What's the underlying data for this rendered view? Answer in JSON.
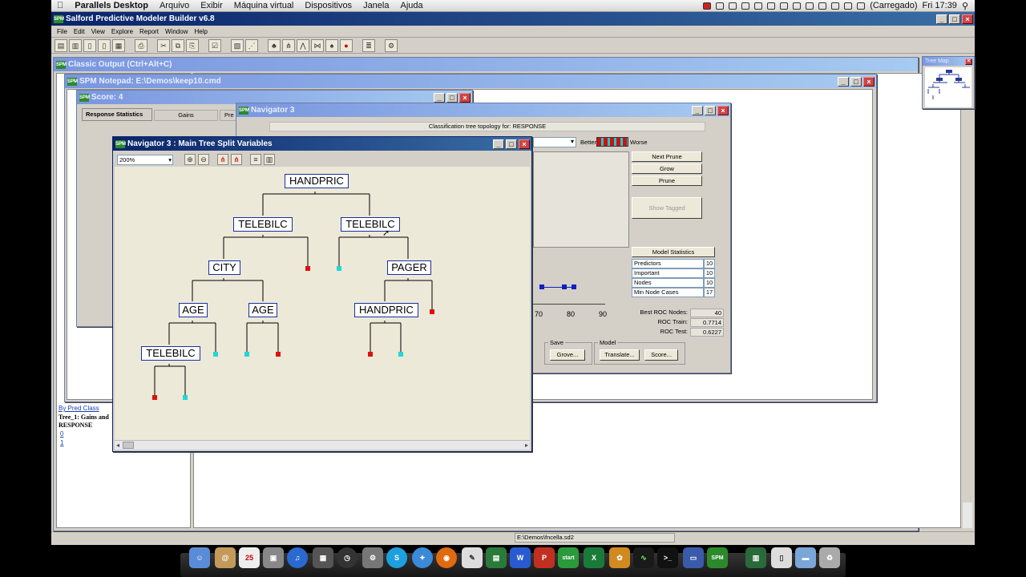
{
  "mac_menu": {
    "app": "Parallels Desktop",
    "items": [
      "Arquivo",
      "Exibir",
      "Máquina virtual",
      "Dispositivos",
      "Janela",
      "Ajuda"
    ],
    "battery": "(Carregado)",
    "clock": "Fri 17:39"
  },
  "app": {
    "title": "Salford Predictive Modeler Builder v6.8",
    "menu": [
      "File",
      "Edit",
      "View",
      "Explore",
      "Report",
      "Window",
      "Help"
    ]
  },
  "classic_output": {
    "title": "Classic Output (Ctrl+Alt+C)",
    "bottom_link": "By Pred Class",
    "bottom_line1": "Tree_1: Gains and",
    "bottom_line2": "RESPONSE",
    "bottom_v0": "0",
    "bottom_v1": "1"
  },
  "notepad": {
    "title": "SPM Notepad: E:\\Demos\\keep10.cmd"
  },
  "score": {
    "title": "Score: 4",
    "tabs": [
      "Response Statistics",
      "Gains",
      "Pre"
    ]
  },
  "navigator3": {
    "title": "Navigator 3",
    "topology_label": "Classification tree topology for: RESPONSE",
    "better": "Better",
    "worse": "Worse",
    "buttons": {
      "next_prune": "Next Prune",
      "grow": "Grow",
      "prune": "Prune",
      "show_tagged": "Show Tagged"
    },
    "model_statistics": {
      "header": "Model Statistics",
      "rows": [
        {
          "label": "Predictors",
          "value": "10"
        },
        {
          "label": "Important",
          "value": "10"
        },
        {
          "label": "Nodes",
          "value": "10"
        },
        {
          "label": "Min Node Cases",
          "value": "17"
        }
      ]
    },
    "roc": [
      {
        "label": "Best ROC Nodes:",
        "value": "40"
      },
      {
        "label": "ROC Train:",
        "value": "0.7714"
      },
      {
        "label": "ROC Test:",
        "value": "0.6227"
      }
    ],
    "axis_ticks": [
      "70",
      "80",
      "90"
    ],
    "save_group": "Save",
    "grove_btn": "Grove...",
    "model_group": "Model",
    "translate_btn": "Translate...",
    "score_btn": "Score..."
  },
  "main_tree": {
    "title": "Navigator 3 : Main Tree Split Variables",
    "zoom": "200%",
    "nodes": {
      "root": "HANDPRIC",
      "l": "TELEBILC",
      "r": "TELEBILC",
      "ll": "CITY",
      "rr": "PAGER",
      "lll": "AGE",
      "llr": "AGE",
      "rrl": "HANDPRIC",
      "llll": "TELEBILC"
    },
    "leaf_colors": {
      "red": "#e01010",
      "cyan": "#20d8d8"
    }
  },
  "tree_map": {
    "title": "Tree Map"
  },
  "status_bar": {
    "path": "E:\\Demos\\fncella.sd2"
  }
}
